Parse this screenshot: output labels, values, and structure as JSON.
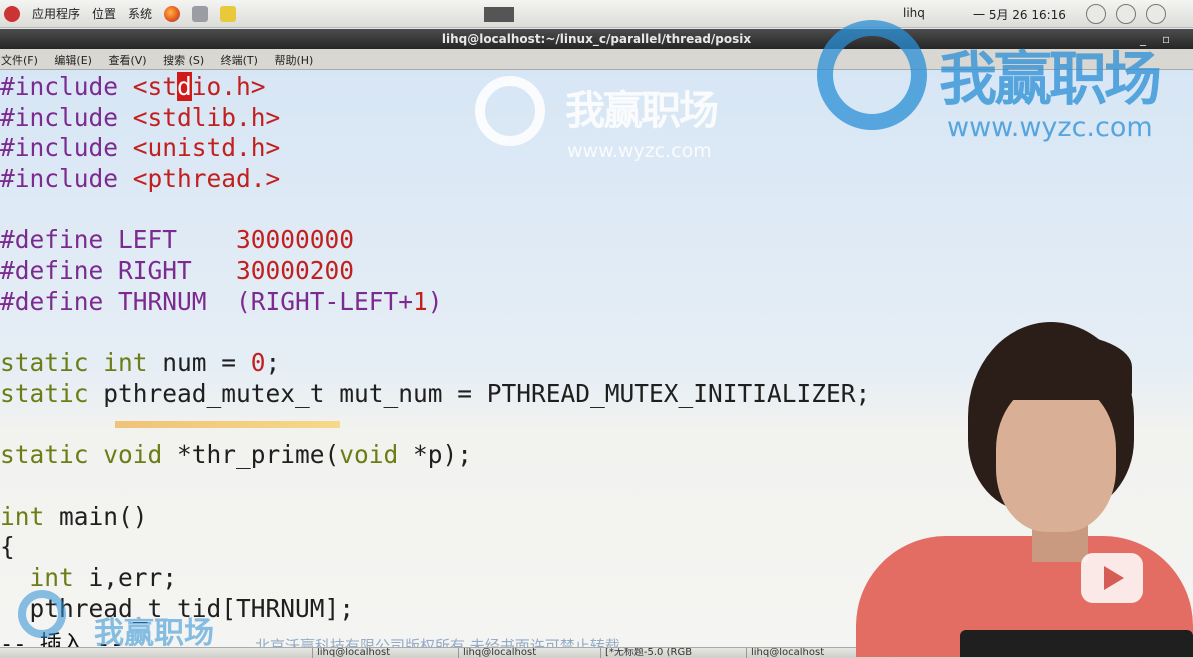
{
  "top_panel": {
    "menu_items": [
      "应用程序",
      "位置",
      "系统"
    ],
    "user": "lihq",
    "clock": "一 5月 26 16:16"
  },
  "window": {
    "title": "lihq@localhost:~/linux_c/parallel/thread/posix",
    "menu": [
      "文件(F)",
      "编辑(E)",
      "查看(V)",
      "搜索 (S)",
      "终端(T)",
      "帮助(H)"
    ]
  },
  "editor": {
    "lines": [
      [
        [
          "pp",
          "#include "
        ],
        [
          "hdr",
          "<st"
        ],
        [
          "cursor",
          "d"
        ],
        [
          "hdr",
          "io.h>"
        ]
      ],
      [
        [
          "pp",
          "#include "
        ],
        [
          "hdr",
          "<stdlib.h>"
        ]
      ],
      [
        [
          "pp",
          "#include "
        ],
        [
          "hdr",
          "<unistd.h>"
        ]
      ],
      [
        [
          "pp",
          "#include "
        ],
        [
          "hdr",
          "<pthread.>"
        ]
      ],
      [],
      [
        [
          "pp",
          "#define LEFT    "
        ],
        [
          "num",
          "30000000"
        ]
      ],
      [
        [
          "pp",
          "#define RIGHT   "
        ],
        [
          "num",
          "30000200"
        ]
      ],
      [
        [
          "pp",
          "#define THRNUM  (RIGHT-LEFT+"
        ],
        [
          "num",
          "1"
        ],
        [
          "pp",
          ")"
        ]
      ],
      [],
      [
        [
          "kw",
          "static int"
        ],
        [
          "txt",
          " num = "
        ],
        [
          "num",
          "0"
        ],
        [
          "txt",
          ";"
        ]
      ],
      [
        [
          "kw",
          "static"
        ],
        [
          "txt",
          " pthread_mutex_t mut_num = PTHREAD_MUTEX_INITIALIZER;"
        ]
      ],
      [],
      [
        [
          "kw",
          "static void"
        ],
        [
          "txt",
          " *thr_prime("
        ],
        [
          "kw",
          "void"
        ],
        [
          "txt",
          " *p);"
        ]
      ],
      [],
      [
        [
          "kw",
          "int"
        ],
        [
          "txt",
          " main()"
        ]
      ],
      [
        [
          "txt",
          "{"
        ]
      ],
      [
        [
          "txt",
          "  "
        ],
        [
          "kw",
          "int"
        ],
        [
          "txt",
          " i,err;"
        ]
      ],
      [
        [
          "txt",
          "  pthread_t tid[THRNUM];"
        ]
      ]
    ],
    "status_line": "-- 插入 --"
  },
  "watermark": {
    "brand": "我赢职场",
    "url": "www.wyzc.com",
    "copyright": "北京沃赢科技有限公司版权所有 未经书面许可禁止转载"
  },
  "taskbar": {
    "items": [
      "lihq@localhost",
      "lihq@localhost",
      "[*无标题-5.0 (RGB",
      "lihq@localhost"
    ]
  },
  "colors": {
    "preprocessor": "#7b2b8f",
    "string_or_number": "#c21f1f",
    "keyword": "#6b7d14",
    "cursor": "#d11919"
  },
  "icons": [
    "app-menu-icon",
    "firefox-icon",
    "mail-icon",
    "notes-icon",
    "network-icon",
    "volume-icon",
    "play-icon"
  ]
}
